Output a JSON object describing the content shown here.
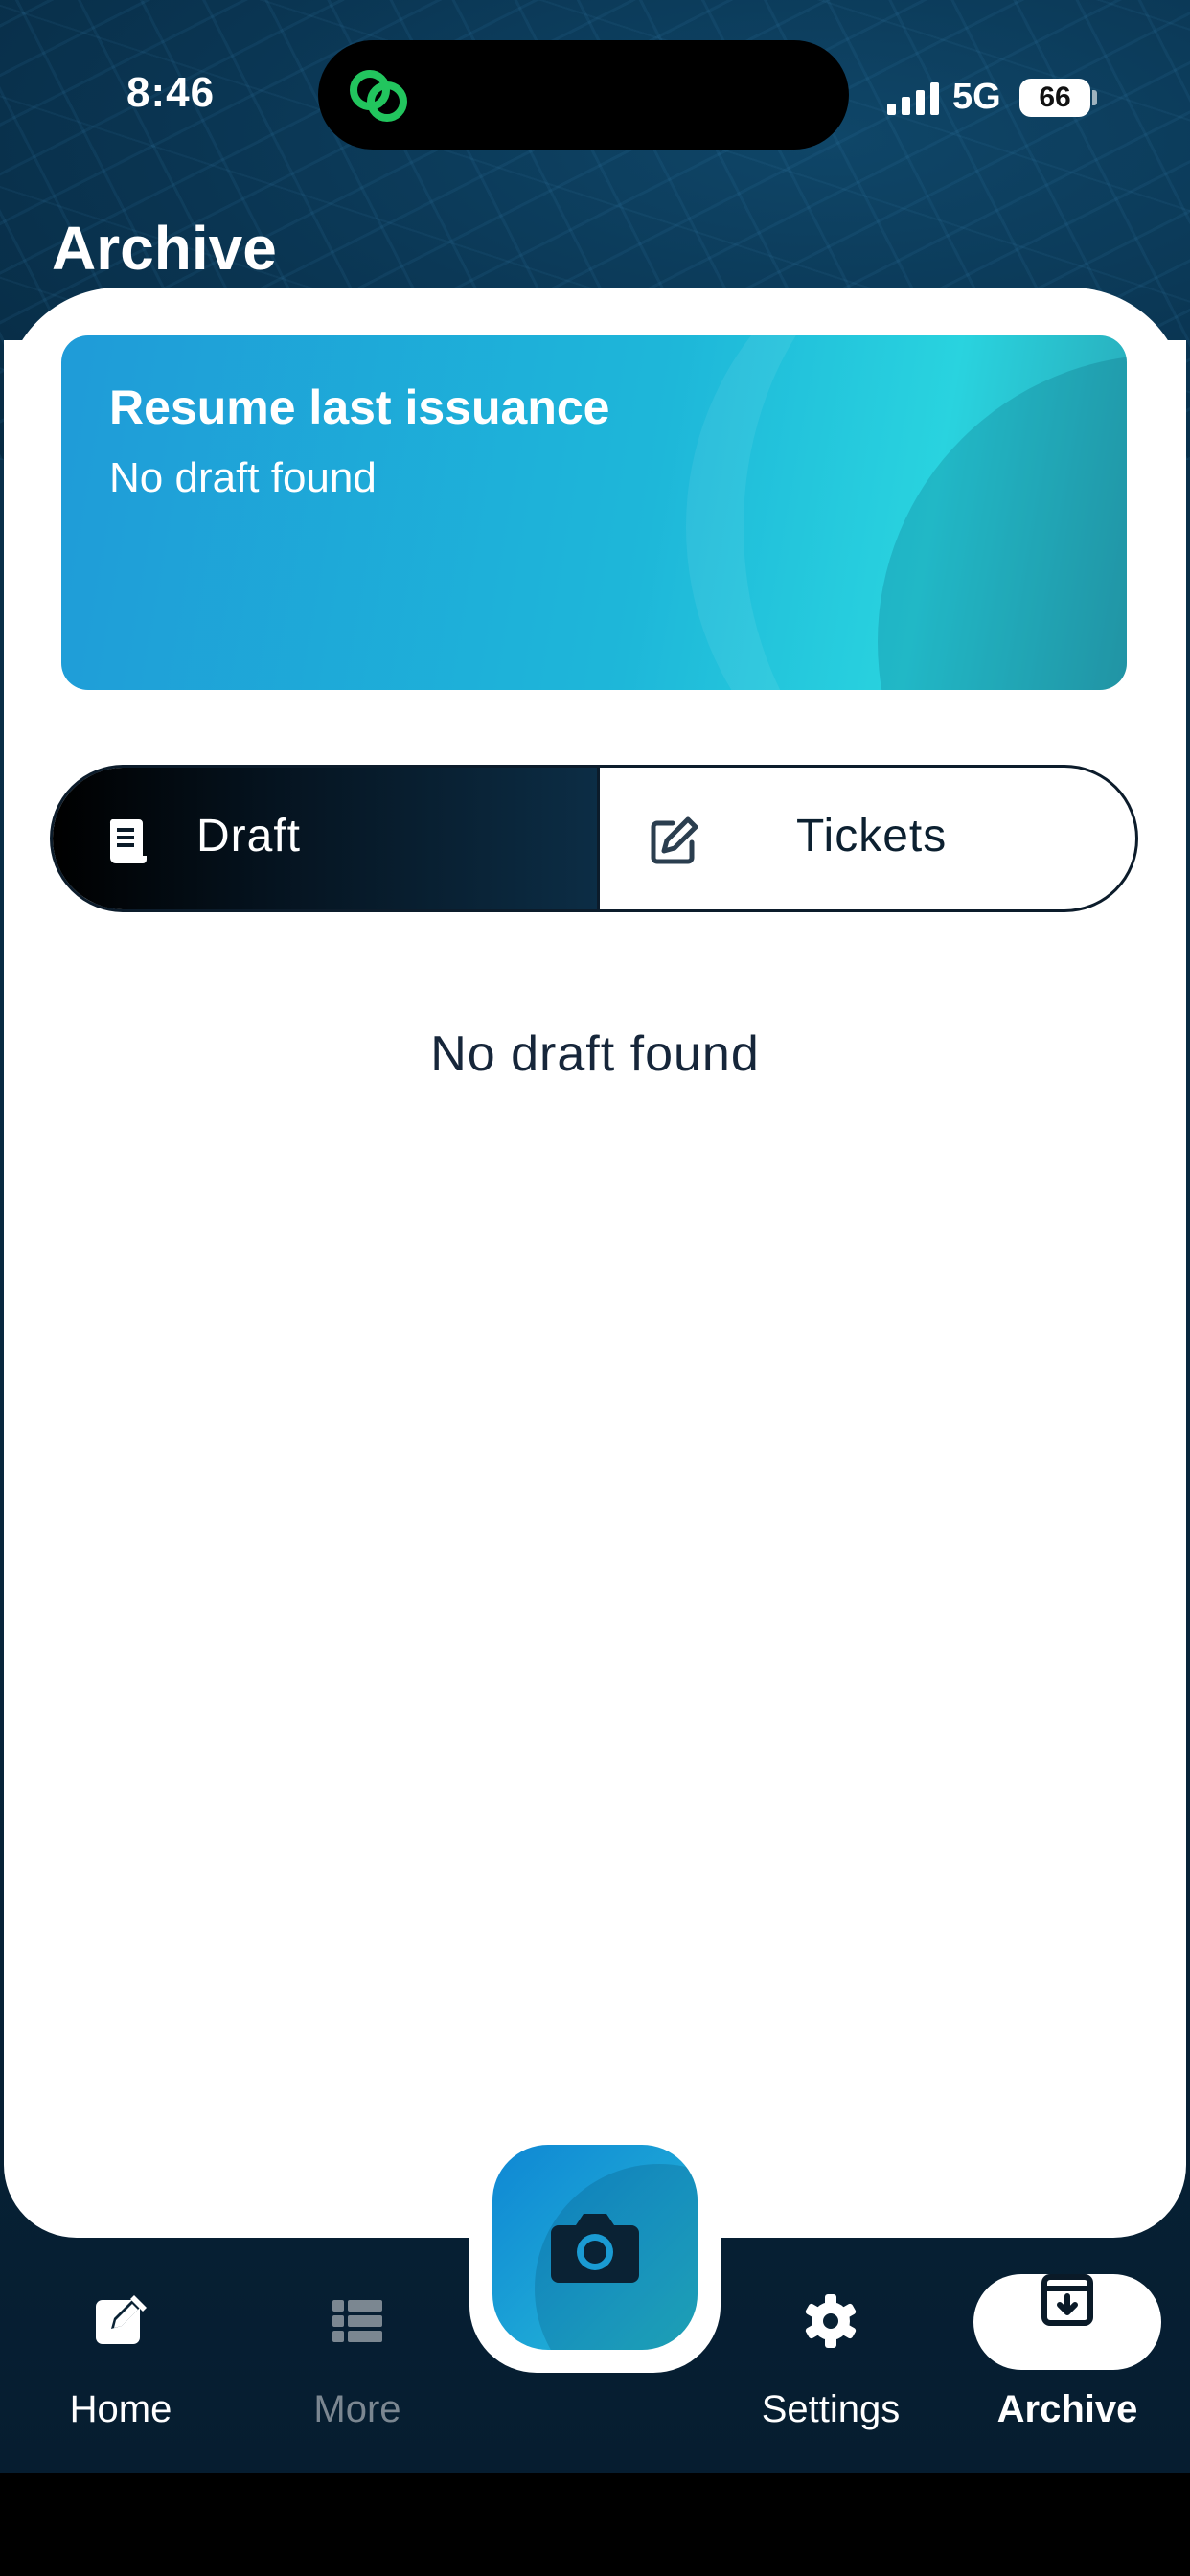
{
  "status_bar": {
    "time": "8:46",
    "network": "5G",
    "battery": "66"
  },
  "header": {
    "title": "Archive"
  },
  "resume_card": {
    "title": "Resume last issuance",
    "subtitle": "No draft found"
  },
  "segments": [
    {
      "label": "Draft",
      "icon": "receipt-icon",
      "selected": true
    },
    {
      "label": "Tickets",
      "icon": "edit-square-icon",
      "selected": false
    }
  ],
  "content": {
    "empty_message": "No draft found"
  },
  "tabbar": {
    "items": [
      {
        "label": "Home",
        "icon": "edit-square-icon"
      },
      {
        "label": "More",
        "icon": "list-icon"
      },
      {
        "label": "Settings",
        "icon": "gear-icon"
      },
      {
        "label": "Archive",
        "icon": "archive-icon",
        "active": true
      }
    ],
    "center_action_icon": "camera-icon"
  },
  "colors": {
    "accent": "#1da7d6",
    "dark": "#061d30",
    "text": "#16263a"
  }
}
